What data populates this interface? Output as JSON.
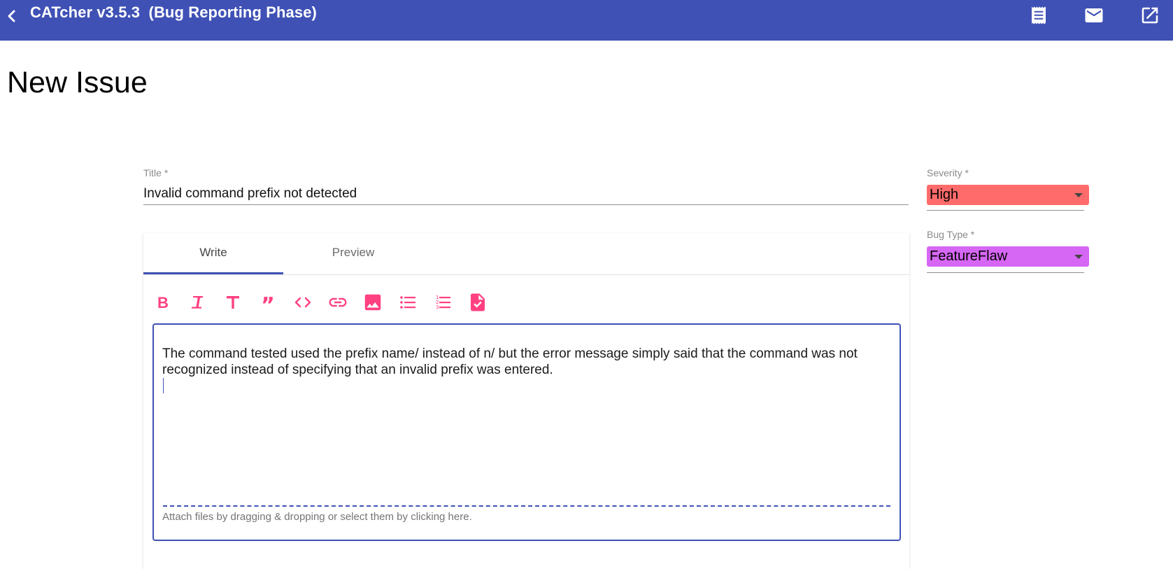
{
  "app": {
    "title": "CATcher v3.5.3  (Bug Reporting Phase)"
  },
  "page": {
    "title": "New Issue"
  },
  "form": {
    "title_label": "Title *",
    "title_value": "Invalid command prefix not detected",
    "severity_label": "Severity *",
    "severity_value": "High",
    "bug_type_label": "Bug Type *",
    "bug_type_value": "FeatureFlaw"
  },
  "tabs": [
    {
      "label": "Write",
      "active": true
    },
    {
      "label": "Preview",
      "active": false
    }
  ],
  "toolbar": [
    "bold-icon",
    "italic-icon",
    "heading-icon",
    "quote-icon",
    "code-icon",
    "link-icon",
    "image-icon",
    "bulleted-list-icon",
    "numbered-list-icon",
    "task-list-icon"
  ],
  "editor": {
    "text": "The command tested used the prefix name/ instead of n/ but the error message simply said that the command was not recognized instead of specifying that an invalid prefix was entered.",
    "attach_text": "Attach files by dragging & dropping or select them by clicking here."
  },
  "colors": {
    "primary": "#3f51b5",
    "accent": "#ff4081",
    "severity_high": "#ff6b6b",
    "bug_type_featureflaw": "#d666f4"
  },
  "header_icons": [
    "receipt-icon",
    "mail-icon",
    "open-in-new-icon"
  ]
}
